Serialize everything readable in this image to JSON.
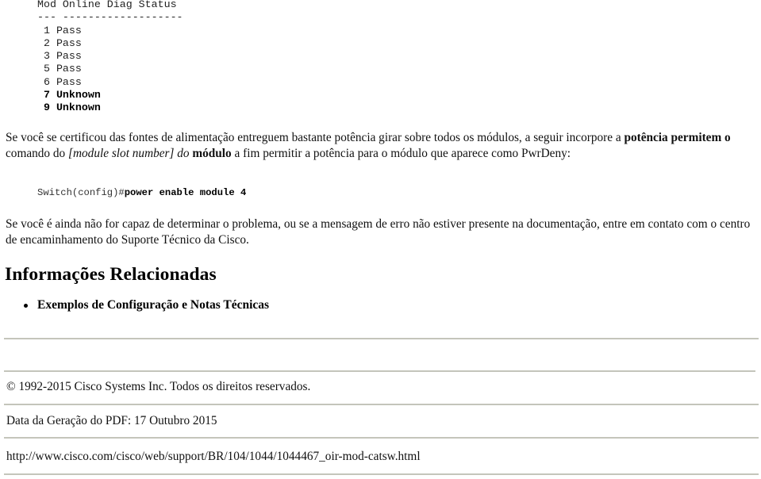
{
  "diag_table": {
    "header": "Mod Online Diag Status",
    "separator": "--- -------------------",
    "rows": [
      {
        "mod": "1",
        "status": "Pass",
        "bold": false
      },
      {
        "mod": "2",
        "status": "Pass",
        "bold": false
      },
      {
        "mod": "3",
        "status": "Pass",
        "bold": false
      },
      {
        "mod": "5",
        "status": "Pass",
        "bold": false
      },
      {
        "mod": "6",
        "status": "Pass",
        "bold": false
      },
      {
        "mod": "7",
        "status": "Unknown",
        "bold": true
      },
      {
        "mod": "9",
        "status": "Unknown",
        "bold": true
      }
    ]
  },
  "paragraph1": {
    "text_a": "Se você se certificou das fontes de alimentação entreguem bastante potência girar sobre todos os módulos, a seguir incorpore a ",
    "bold_a": "potência permitem o",
    "text_b": " comando do ",
    "italic_a": "[module slot number] do",
    "text_c": " ",
    "bold_b": "módulo",
    "text_d": " a fim permitir a potência para o módulo que aparece como PwrDeny:"
  },
  "command": {
    "prompt": "Switch(config)#",
    "command": "power enable module 4"
  },
  "paragraph2": "Se você é ainda não for capaz de determinar o problema, ou se a mensagem de erro não estiver presente na documentação, entre em contato com o centro de encaminhamento do Suporte Técnico da Cisco.",
  "related": {
    "heading": "Informações Relacionadas",
    "links": [
      {
        "label": "Exemplos de Configuração e Notas Técnicas"
      }
    ]
  },
  "footer": {
    "copyright": "© 1992-2015 Cisco Systems Inc. Todos os direitos reservados.",
    "pdf_date": "Data da Geração do PDF: 17 Outubro 2015",
    "url": "http://www.cisco.com/cisco/web/support/BR/104/1044/1044467_oir-mod-catsw.html"
  }
}
